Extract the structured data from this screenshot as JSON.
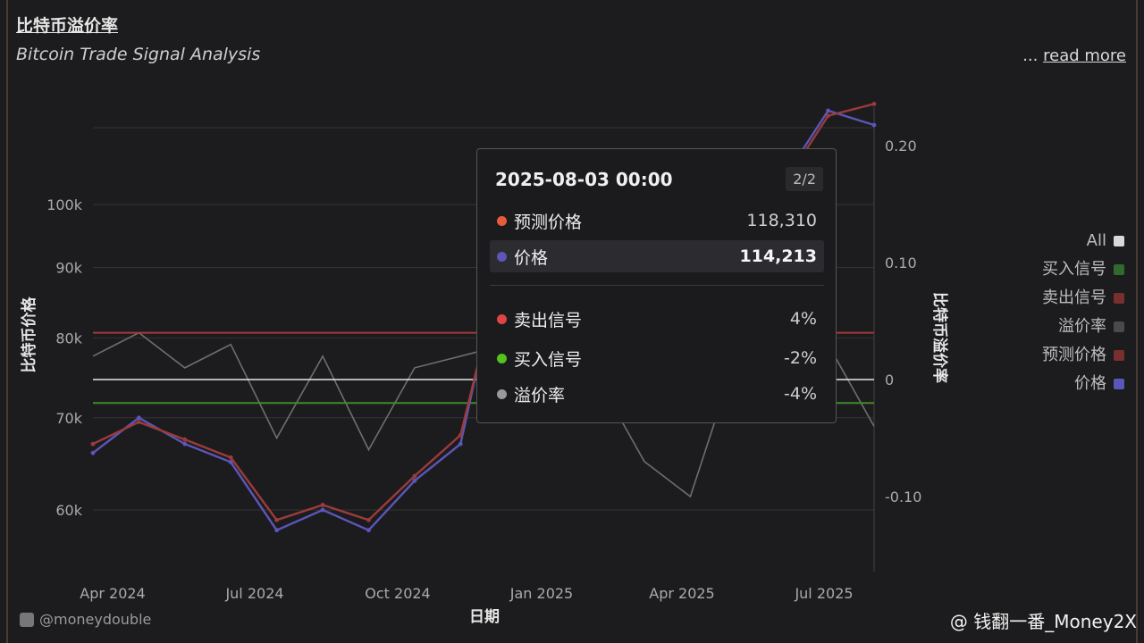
{
  "header": {
    "title": "比特币溢价率",
    "subtitle": "Bitcoin Trade Signal Analysis",
    "read_more_prefix": "...",
    "read_more": "read more"
  },
  "legend": {
    "items": [
      {
        "label": "All",
        "color": "#d9d9d9"
      },
      {
        "label": "买入信号",
        "color": "#2f6b2f"
      },
      {
        "label": "卖出信号",
        "color": "#7a2f2f"
      },
      {
        "label": "溢价率",
        "color": "#4a4a4a"
      },
      {
        "label": "预测价格",
        "color": "#7a2f2f"
      },
      {
        "label": "价格",
        "color": "#5b56b8"
      }
    ]
  },
  "tooltip": {
    "date": "2025-08-03 00:00",
    "page": "2/2",
    "rows": [
      {
        "label": "预测价格",
        "value": "118,310",
        "color": "#e85a3c",
        "highlight": false
      },
      {
        "label": "价格",
        "value": "114,213",
        "color": "#5b56b8",
        "highlight": true
      },
      {
        "label": "卖出信号",
        "value": "4%",
        "color": "#e04545",
        "highlight": false
      },
      {
        "label": "买入信号",
        "value": "-2%",
        "color": "#52c41a",
        "highlight": false
      },
      {
        "label": "溢价率",
        "value": "-4%",
        "color": "#9a9a9a",
        "highlight": false
      }
    ]
  },
  "footer": {
    "handle": "@moneydouble",
    "watermark": "@ 钱翻一番_Money2X"
  },
  "chart_data": {
    "type": "line",
    "xlabel": "日期",
    "ylabel_left": "比特币价格",
    "ylabel_right": "比特币溢价率",
    "x_ticks": [
      "Apr 2024",
      "Jul 2024",
      "Oct 2024",
      "Jan 2025",
      "Apr 2025",
      "Jul 2025"
    ],
    "y_left_ticks": [
      "60k",
      "70k",
      "80k",
      "90k",
      "100k"
    ],
    "y_right_ticks": [
      "0.20",
      "0.10",
      "0",
      "-0.10"
    ],
    "y_left_log": true,
    "sell_signal": 0.04,
    "buy_signal": -0.02,
    "x": [
      "2024-03",
      "2024-04",
      "2024-05",
      "2024-06",
      "2024-07",
      "2024-08",
      "2024-09",
      "2024-10",
      "2024-11",
      "2024-12",
      "2025-01",
      "2025-02",
      "2025-03",
      "2025-04",
      "2025-05",
      "2025-06",
      "2025-07",
      "2025-08"
    ],
    "series": [
      {
        "name": "价格",
        "color": "#5b56b8",
        "values": [
          66000,
          70000,
          67000,
          65000,
          58000,
          60000,
          58000,
          63000,
          67000,
          95000,
          98000,
          96000,
          88000,
          84000,
          92000,
          104000,
          117000,
          114213
        ]
      },
      {
        "name": "预测价格",
        "color": "#9b3b3b",
        "values": [
          67000,
          69500,
          67500,
          65500,
          59000,
          60500,
          59000,
          63500,
          68000,
          93000,
          97000,
          95000,
          89000,
          86000,
          93000,
          103000,
          116000,
          118310
        ]
      },
      {
        "name": "溢价率",
        "color": "#6e6e6e",
        "values": [
          0.02,
          0.04,
          0.01,
          0.03,
          -0.05,
          0.02,
          -0.06,
          0.01,
          0.02,
          0.03,
          0.1,
          0.0,
          -0.07,
          -0.1,
          0.02,
          0.05,
          0.03,
          -0.04
        ]
      }
    ]
  }
}
